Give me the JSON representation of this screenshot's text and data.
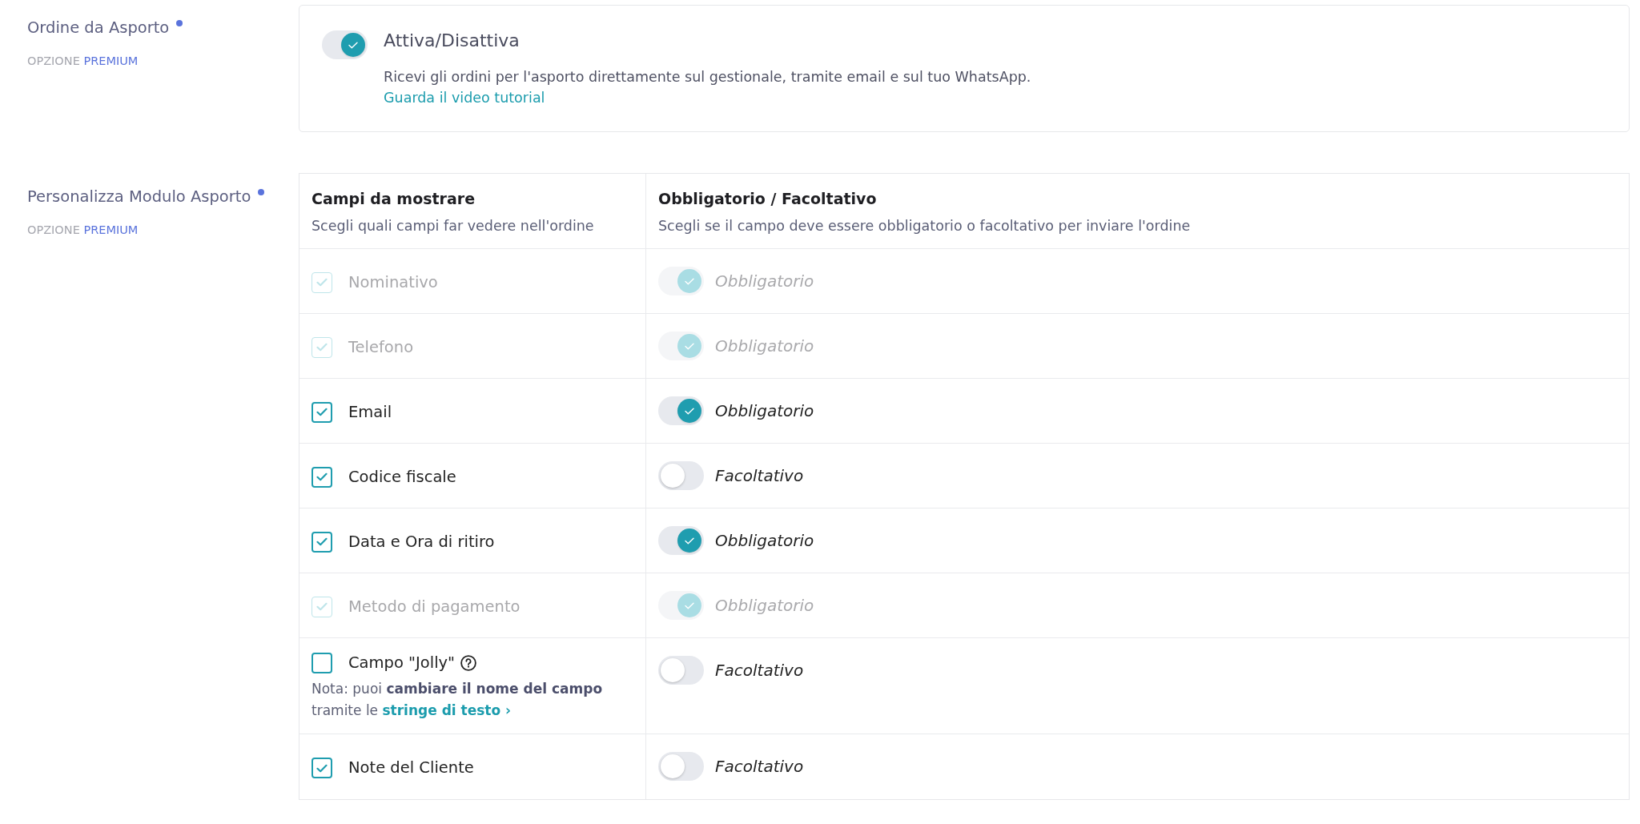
{
  "takeaway_order": {
    "label": "Ordine da Asporto",
    "option": "OPZIONE",
    "tier": "PREMIUM",
    "enabled": true,
    "title": "Attiva/Disattiva",
    "description": "Ricevi gli ordini per l'asporto direttamente sul gestionale, tramite email e sul tuo WhatsApp.",
    "link": "Guarda il video tutorial"
  },
  "form_fields": {
    "label": "Personalizza Modulo Asporto",
    "option": "OPZIONE",
    "tier": "PREMIUM",
    "columns": [
      {
        "title": "Campi da mostrare",
        "subtitle": "Scegli quali campi far vedere nell'ordine"
      },
      {
        "title": "Obbligatorio / Facoltativo",
        "subtitle": "Scegli se il campo deve essere obbligatorio o facoltativo per inviare l'ordine"
      }
    ],
    "rows": [
      {
        "name": "Nominativo",
        "checked": true,
        "disabled": true,
        "help": false,
        "required": true,
        "requirement": "Obbligatorio"
      },
      {
        "name": "Telefono",
        "checked": true,
        "disabled": true,
        "help": false,
        "required": true,
        "requirement": "Obbligatorio"
      },
      {
        "name": "Email",
        "checked": true,
        "disabled": false,
        "help": false,
        "required": true,
        "requirement": "Obbligatorio"
      },
      {
        "name": "Codice fiscale",
        "checked": true,
        "disabled": false,
        "help": false,
        "required": false,
        "requirement": "Facoltativo"
      },
      {
        "name": "Data e Ora di ritiro",
        "checked": true,
        "disabled": false,
        "help": false,
        "required": true,
        "requirement": "Obbligatorio"
      },
      {
        "name": "Metodo di pagamento",
        "checked": true,
        "disabled": true,
        "help": false,
        "required": true,
        "requirement": "Obbligatorio"
      },
      {
        "name": "Campo \"Jolly\"",
        "checked": false,
        "disabled": false,
        "help": true,
        "required": false,
        "requirement": "Facoltativo",
        "note": "Nota: puoi **cambiare il nome del campo** tramite le",
        "note_link": "stringe di testo ›"
      },
      {
        "name": "Note del Cliente",
        "checked": true,
        "disabled": false,
        "help": false,
        "required": false,
        "requirement": "Facoltativo"
      }
    ]
  }
}
